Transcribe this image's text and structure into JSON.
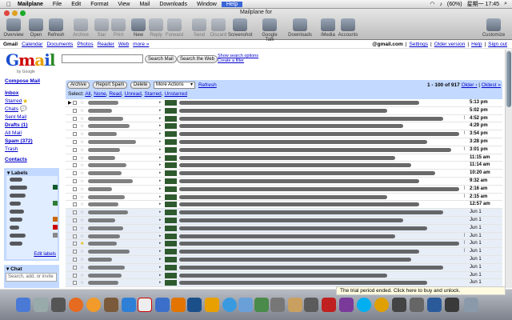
{
  "menubar": {
    "app": "Mailplane",
    "items": [
      "File",
      "Edit",
      "Format",
      "View",
      "Mail",
      "Downloads",
      "Window",
      "Help"
    ],
    "battery": "(60%)",
    "clock": "星期一 17:45"
  },
  "window": {
    "title": "Mailplane for "
  },
  "toolbar": [
    {
      "label": "Overview",
      "dis": false
    },
    {
      "label": "Open",
      "dis": false
    },
    {
      "label": "Refresh",
      "dis": false
    },
    {
      "label": "Archive",
      "dis": true
    },
    {
      "label": "Star",
      "dis": true
    },
    {
      "label": "Print",
      "dis": true
    },
    {
      "label": "New",
      "dis": false
    },
    {
      "label": "Reply",
      "dis": true
    },
    {
      "label": "Forward",
      "dis": true
    },
    {
      "label": "Send",
      "dis": true
    },
    {
      "label": "Discard",
      "dis": true
    },
    {
      "label": "Screenshot",
      "dis": false
    },
    {
      "label": "Google Talk",
      "dis": false
    },
    {
      "label": "Downloads",
      "dis": false
    },
    {
      "label": "iMedia",
      "dis": false
    },
    {
      "label": "Accounts",
      "dis": false
    },
    {
      "label": "Customize",
      "dis": false
    }
  ],
  "gmail_nav": {
    "brand": "Gmail",
    "links": [
      "Calendar",
      "Documents",
      "Photos",
      "Reader",
      "Web",
      "more »"
    ],
    "account_suffix": "@gmail.com",
    "right_links": [
      "Settings",
      "Older version",
      "Help",
      "Sign out"
    ]
  },
  "logo": {
    "text": "Gmail",
    "sub": "by Google"
  },
  "search": {
    "mail_btn": "Search Mail",
    "web_btn": "Search the Web",
    "options": "Show search options",
    "filter": "Create a filter"
  },
  "sidebar": {
    "compose": "Compose Mail",
    "items": [
      "Inbox",
      "Starred",
      "Chats",
      "Sent Mail",
      "Drafts (1)",
      "All Mail",
      "Spam (372)",
      "Trash"
    ],
    "contacts": "Contacts",
    "labels_header": "Labels",
    "edit_labels": "Edit labels",
    "chat_header": "Chat",
    "chat_placeholder": "Search, add, or invite"
  },
  "actions": {
    "archive": "Archive",
    "report_spam": "Report Spam",
    "delete": "Delete",
    "more_actions": "More Actions",
    "refresh": "Refresh",
    "range": "1 - 100 of 917",
    "older": "Older ›",
    "oldest": "Oldest »",
    "select_prefix": "Select:",
    "select_opts": [
      "All",
      "None",
      "Read",
      "Unread",
      "Starred",
      "Unstarred"
    ]
  },
  "label_colors": [
    "#0a5a2a",
    "#cc6600",
    "#888888",
    "#2e7d32"
  ],
  "emails": [
    {
      "date": "5:13 pm",
      "unread": true,
      "clip": false
    },
    {
      "date": "5:02 pm",
      "unread": true,
      "clip": false
    },
    {
      "date": "4:52 pm",
      "unread": true,
      "clip": true
    },
    {
      "date": "4:29 pm",
      "unread": true,
      "clip": false
    },
    {
      "date": "3:54 pm",
      "unread": true,
      "clip": true
    },
    {
      "date": "3:28 pm",
      "unread": true,
      "clip": false
    },
    {
      "date": "3:01 pm",
      "unread": true,
      "clip": true
    },
    {
      "date": "11:15 am",
      "unread": true,
      "clip": false
    },
    {
      "date": "11:14 am",
      "unread": true,
      "clip": false
    },
    {
      "date": "10:20 am",
      "unread": true,
      "clip": false
    },
    {
      "date": "9:32 am",
      "unread": true,
      "clip": false
    },
    {
      "date": "2:16 am",
      "unread": true,
      "clip": true
    },
    {
      "date": "2:15 am",
      "unread": true,
      "clip": true
    },
    {
      "date": "12:57 am",
      "unread": true,
      "clip": false
    },
    {
      "date": "Jun 1",
      "unread": false,
      "clip": false
    },
    {
      "date": "Jun 1",
      "unread": false,
      "clip": false
    },
    {
      "date": "Jun 1",
      "unread": false,
      "clip": false
    },
    {
      "date": "Jun 1",
      "unread": false,
      "clip": true
    },
    {
      "date": "Jun 1",
      "unread": false,
      "clip": true
    },
    {
      "date": "Jun 1",
      "unread": false,
      "clip": true
    },
    {
      "date": "Jun 1",
      "unread": false,
      "clip": false
    },
    {
      "date": "Jun 1",
      "unread": false,
      "clip": false
    },
    {
      "date": "Jun 1",
      "unread": false,
      "clip": false
    },
    {
      "date": "Jun 1",
      "unread": false,
      "clip": false
    }
  ],
  "trial": "The trial period ended. Click here to buy and unlock."
}
